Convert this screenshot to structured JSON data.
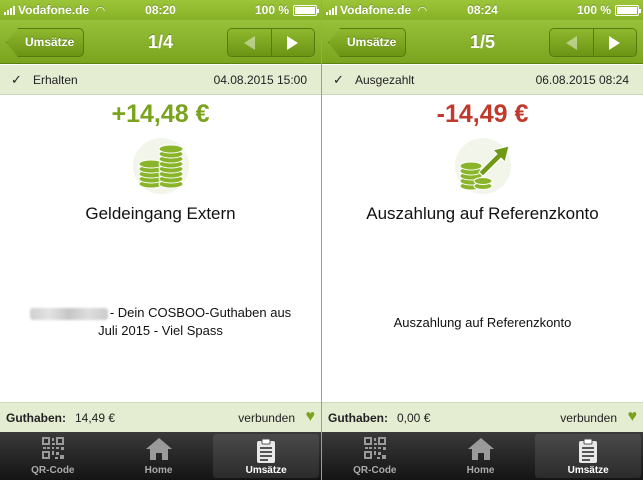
{
  "screens": [
    {
      "status_bar": {
        "carrier": "Vodafone.de",
        "time": "08:20",
        "battery": "100 %",
        "battery_level": 1.0
      },
      "nav": {
        "back_label": "Umsätze",
        "title": "1/4"
      },
      "tx_status": {
        "label": "Erhalten",
        "datetime": "04.08.2015 15:00"
      },
      "amount": "+14,48 €",
      "amount_color": "#7aa31e",
      "icon": "coin-stack-icon",
      "title": "Geldeingang Extern",
      "description_line1": "- Dein COSBOO-Guthaben aus",
      "description_line2": "Juli 2015 - Viel Spass",
      "balance": {
        "label": "Guthaben:",
        "value": "14,49 €",
        "connection": "verbunden"
      },
      "tabs": [
        {
          "label": "QR-Code",
          "icon": "qr-code-icon"
        },
        {
          "label": "Home",
          "icon": "home-icon"
        },
        {
          "label": "Umsätze",
          "icon": "clipboard-icon"
        }
      ]
    },
    {
      "status_bar": {
        "carrier": "Vodafone.de",
        "time": "08:24",
        "battery": "100 %",
        "battery_level": 1.0
      },
      "nav": {
        "back_label": "Umsätze",
        "title": "1/5"
      },
      "tx_status": {
        "label": "Ausgezahlt",
        "datetime": "06.08.2015 08:24"
      },
      "amount": "-14,49 €",
      "amount_color": "#c0392b",
      "icon": "coins-payout-arrow-icon",
      "title": "Auszahlung auf Referenzkonto",
      "description_line1": "Auszahlung auf Referenzkonto",
      "balance": {
        "label": "Guthaben:",
        "value": "0,00 €",
        "connection": "verbunden"
      },
      "tabs": [
        {
          "label": "QR-Code",
          "icon": "qr-code-icon"
        },
        {
          "label": "Home",
          "icon": "home-icon"
        },
        {
          "label": "Umsätze",
          "icon": "clipboard-icon"
        }
      ]
    }
  ],
  "colors": {
    "brand_green": "#8ab52b",
    "positive": "#7aa31e",
    "negative": "#c0392b",
    "row_bg": "#e4ecd2"
  }
}
